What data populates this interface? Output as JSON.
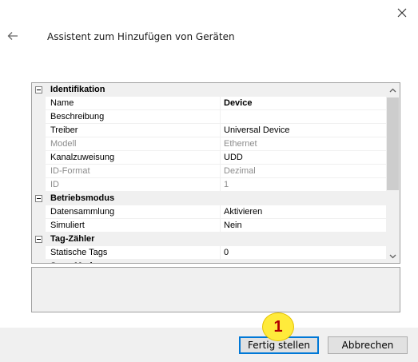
{
  "window": {
    "title": "Assistent zum Hinzufügen von Geräten"
  },
  "property_grid": {
    "categories": [
      {
        "label": "Identifikation",
        "rows": [
          {
            "name": "Name",
            "value": "Device",
            "disabled": false,
            "bold": true
          },
          {
            "name": "Beschreibung",
            "value": "",
            "disabled": false
          },
          {
            "name": "Treiber",
            "value": "Universal Device",
            "disabled": false
          },
          {
            "name": "Modell",
            "value": "Ethernet",
            "disabled": true
          },
          {
            "name": "Kanalzuweisung",
            "value": "UDD",
            "disabled": false
          },
          {
            "name": "ID-Format",
            "value": "Dezimal",
            "disabled": true
          },
          {
            "name": "ID",
            "value": "1",
            "disabled": true
          }
        ]
      },
      {
        "label": "Betriebsmodus",
        "rows": [
          {
            "name": "Datensammlung",
            "value": "Aktivieren",
            "disabled": false
          },
          {
            "name": "Simuliert",
            "value": "Nein",
            "disabled": false
          }
        ]
      },
      {
        "label": "Tag-Zähler",
        "rows": [
          {
            "name": "Statische Tags",
            "value": "0",
            "disabled": false
          }
        ]
      }
    ],
    "partial_category_label": "Scan-Modus"
  },
  "footer": {
    "finish_label": "Fertig stellen",
    "cancel_label": "Abbrechen"
  },
  "annotation": {
    "badge_number": "1"
  },
  "icons": {
    "close": "close-icon",
    "back": "arrow-left-icon",
    "scroll_up": "chevron-up-icon",
    "scroll_down": "chevron-down-icon"
  }
}
